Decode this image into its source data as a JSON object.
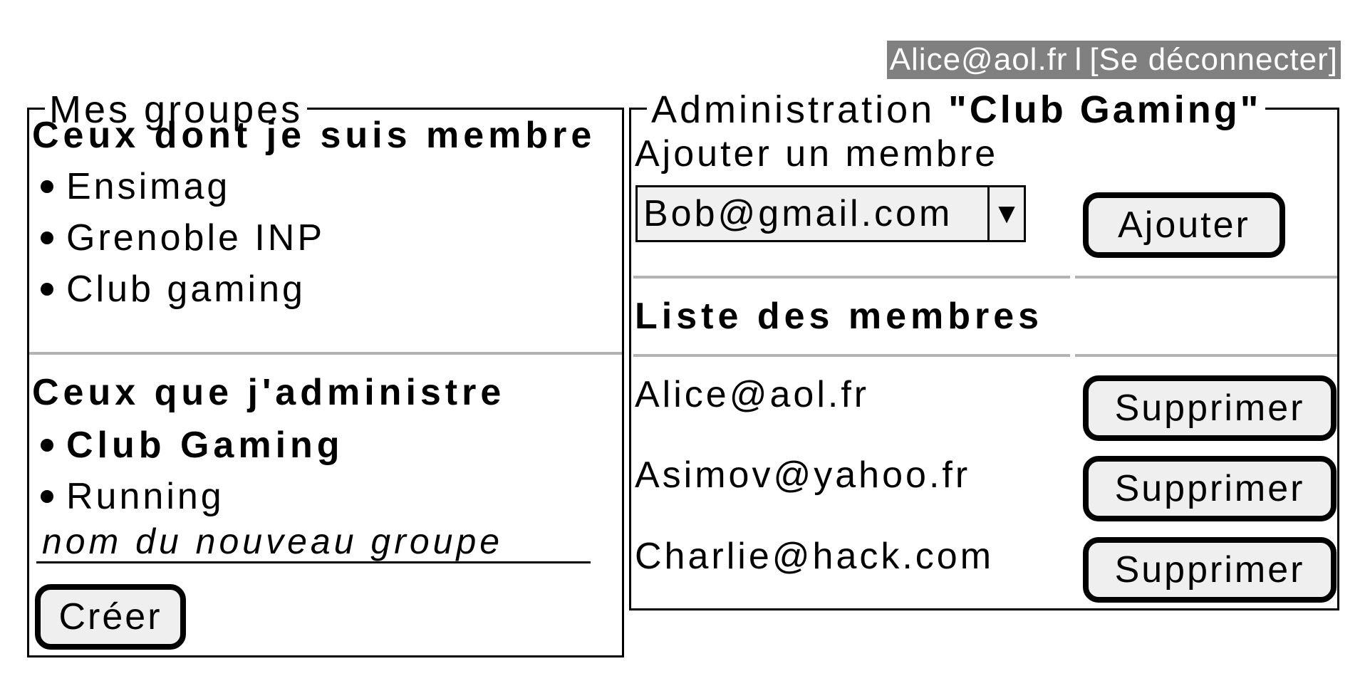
{
  "header": {
    "user_email": "Alice@aol.fr",
    "separator": "l",
    "logout_label": "[Se déconnecter]"
  },
  "groups_panel": {
    "title": "Mes groupes",
    "member_heading": "Ceux dont je suis membre",
    "member_groups": [
      "Ensimag",
      "Grenoble INP",
      "Club gaming"
    ],
    "admin_heading": "Ceux que j'administre",
    "admin_groups": [
      "Club Gaming",
      "Running"
    ],
    "selected_admin_group": "Club Gaming",
    "new_group_placeholder": "nom du nouveau groupe",
    "create_label": "Créer"
  },
  "admin_panel": {
    "title_prefix": "Administration",
    "group_name": "\"Club Gaming\"",
    "add_member_label": "Ajouter un membre",
    "add_member_select_value": "Bob@gmail.com",
    "add_button_label": "Ajouter",
    "members_heading": "Liste des membres",
    "members": [
      "Alice@aol.fr",
      "Asimov@yahoo.fr",
      "Charlie@hack.com"
    ],
    "delete_label": "Supprimer"
  }
}
